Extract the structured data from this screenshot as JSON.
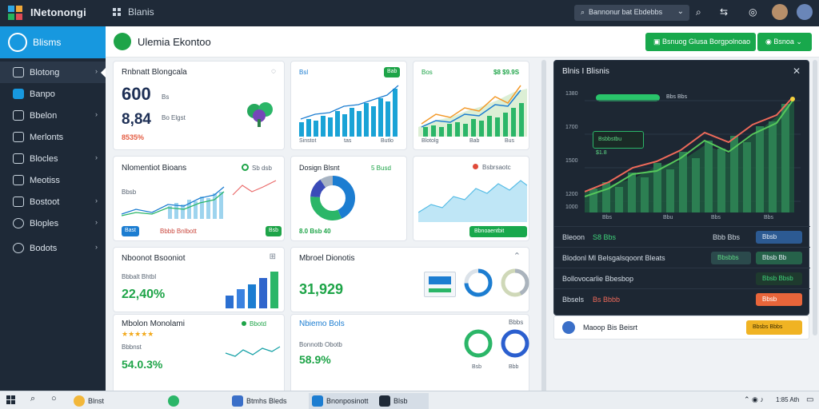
{
  "app": {
    "title": "INetonongi",
    "tab": "Blanis"
  },
  "top": {
    "search_value": "Bannonur bat Ebdebbs"
  },
  "sidebar": {
    "header": "Blisms",
    "items": [
      {
        "label": "Blotong",
        "arrow": "›"
      },
      {
        "label": "Banpo",
        "arrow": ""
      },
      {
        "label": "Bbelon",
        "arrow": "›"
      },
      {
        "label": "Merlonts",
        "arrow": ""
      },
      {
        "label": "Blocles",
        "arrow": "›"
      },
      {
        "label": "Meotiss",
        "arrow": ""
      },
      {
        "label": "Bostoot",
        "arrow": "›"
      },
      {
        "label": "Bloples",
        "arrow": "›"
      },
      {
        "label": "Bodots",
        "arrow": "›"
      }
    ]
  },
  "page": {
    "title": "Ulemia Ekontoo",
    "button_primary": "Bsnuog Glusa Borgpolnoao",
    "button_secondary": "Bsnoa"
  },
  "cards": {
    "c1": {
      "title": "Rnbnatt Blongcala",
      "value": "600",
      "value_suffix": "Bs",
      "value2": "8,84",
      "value2_note": "Bo Elgst",
      "delta": "8535%"
    },
    "c2": {
      "label": "Bsl",
      "pill": "Bab",
      "axis": [
        "Sinstot",
        "tas",
        "Butlo"
      ]
    },
    "c3": {
      "label": "Bos",
      "right": "$8 $9.9S",
      "axis": [
        "Blotolg",
        "Bab",
        "Bus"
      ]
    },
    "c4": {
      "title": "Nlomentiot Bioans",
      "status": "Sb dsb",
      "sub": "Bbsb",
      "pill": "Bast",
      "note": "Bbbb Bnlbott",
      "pill2": "Bsb"
    },
    "c5": {
      "title": "Dosign Blsnt",
      "status": "5 Busd",
      "note": "8.0 Bsb 40"
    },
    "c6": {
      "status": "Bsbrsaotc",
      "btn": "Bbnoaentbit"
    },
    "c7": {
      "title": "Nboonot Bsooniot",
      "sub": "Bbbalt Bhtbl",
      "value": "22,40%"
    },
    "c8": {
      "title": "Mbroel Dionotis",
      "value": "31,929"
    },
    "c9": {
      "title": "Mbolon Monolami",
      "stars": "★★★★★",
      "sub": "Bbbnst",
      "value": "54.0.3%",
      "status": "Bbotd"
    },
    "c10": {
      "title": "Nbiemo Bols",
      "sub": "Bonnotb Obotb",
      "value": "58.9%",
      "ring1": "Bsb",
      "ring2": "Bbb",
      "top": "Bbbs"
    }
  },
  "panel": {
    "title": "Blnis I Blisnis",
    "progress_label": "Bbs Bbs",
    "y_ticks": [
      "1380",
      "1700",
      "1500",
      "1200",
      "1000"
    ],
    "x_ticks": [
      "Bbs",
      "Bbu",
      "Bbs",
      "Bbs"
    ],
    "tooltip": "Bsbbstbu",
    "legend": "$1.8",
    "rows": [
      {
        "k": "Bleoon",
        "v": "S8 Bbs",
        "mid": "Bbb Bbs",
        "btn": "Bbsb"
      },
      {
        "k": "Blodonl Ml Belsgalsqoont Bleats",
        "v": "",
        "mid": "Bbsbbs",
        "btn": "Bbsb Bb"
      },
      {
        "k": "Bollovocarlie Bbesbop",
        "v": "",
        "mid": "",
        "btn": "Bbsb Bbsb"
      },
      {
        "k": "Bbsels",
        "v": "Bs Bbbb",
        "mid": "",
        "btn": "Bbsb"
      }
    ],
    "footer_label": "Maoop Bis Beisrt",
    "footer_btn": "Bbsbs Bbbs"
  },
  "taskbar": {
    "items": [
      "Blnst",
      "",
      "Btmhs Bleds",
      "Bnonposinott",
      "Blsb"
    ],
    "tray": "1:85 Ath"
  },
  "colors": {
    "accent": "#1798df",
    "green": "#18a84c",
    "dark": "#1d2733",
    "blue": "#1c7dd1"
  }
}
